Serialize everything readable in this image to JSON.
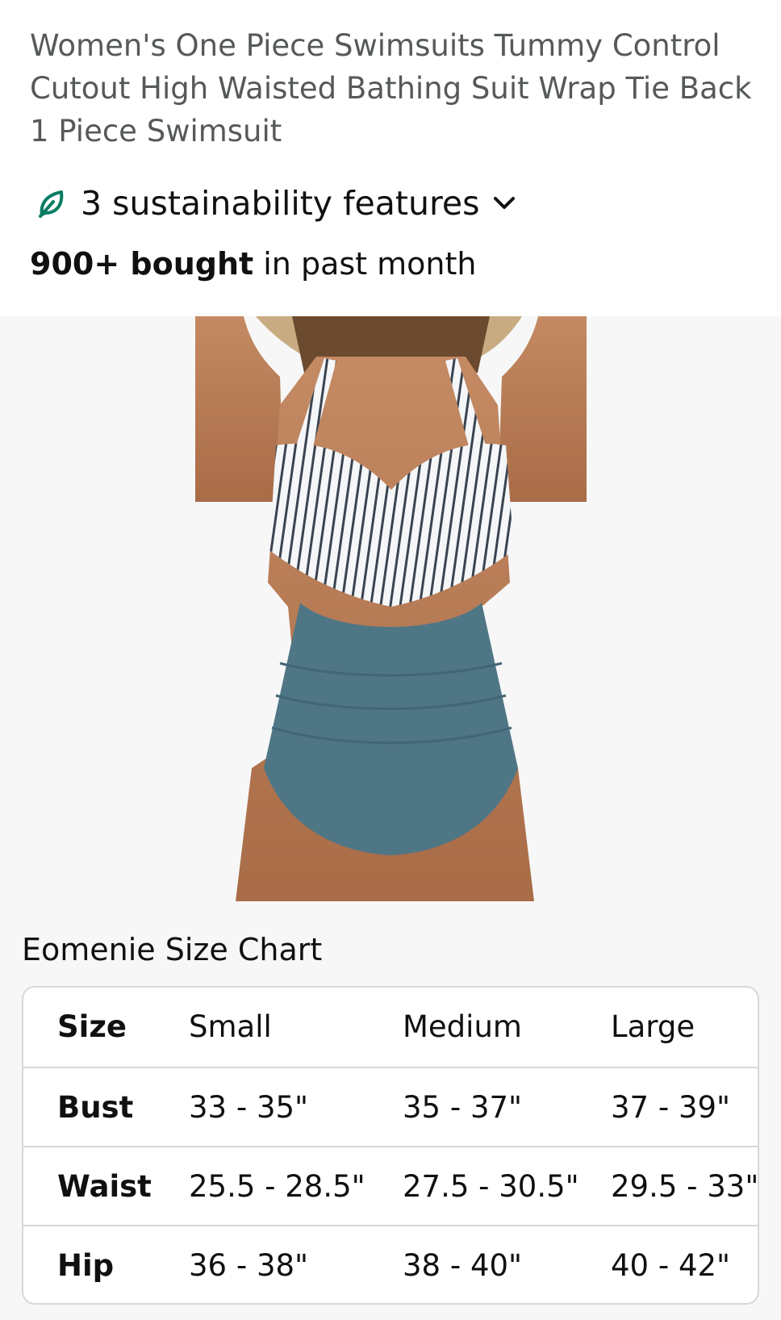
{
  "product": {
    "title": "Women's One Piece Swimsuits Tummy Control Cutout High Waisted Bathing Suit Wrap Tie Back 1 Piece Swimsuit"
  },
  "sustainability": {
    "label": "3 sustainability features",
    "icon": "leaf-icon",
    "expand_icon": "chevron-down-icon",
    "accent_color": "#067d62"
  },
  "social_proof": {
    "bought_count": "900+ bought",
    "bought_suffix": " in past month"
  },
  "product_image": {
    "alt": "Women's one piece swimsuit"
  },
  "size_chart": {
    "title": "Eomenie Size Chart",
    "header": {
      "label": "Size",
      "sizes": [
        "Small",
        "Medium",
        "Large"
      ]
    },
    "rows": [
      {
        "label": "Bust",
        "values": [
          "33 - 35\"",
          "35 - 37\"",
          "37 - 39\""
        ]
      },
      {
        "label": "Waist",
        "values": [
          "25.5 - 28.5\"",
          "27.5 - 30.5\"",
          "29.5 - 33\""
        ]
      },
      {
        "label": "Hip",
        "values": [
          "36 - 38\"",
          "38 - 40\"",
          "40 - 42\""
        ]
      }
    ]
  }
}
